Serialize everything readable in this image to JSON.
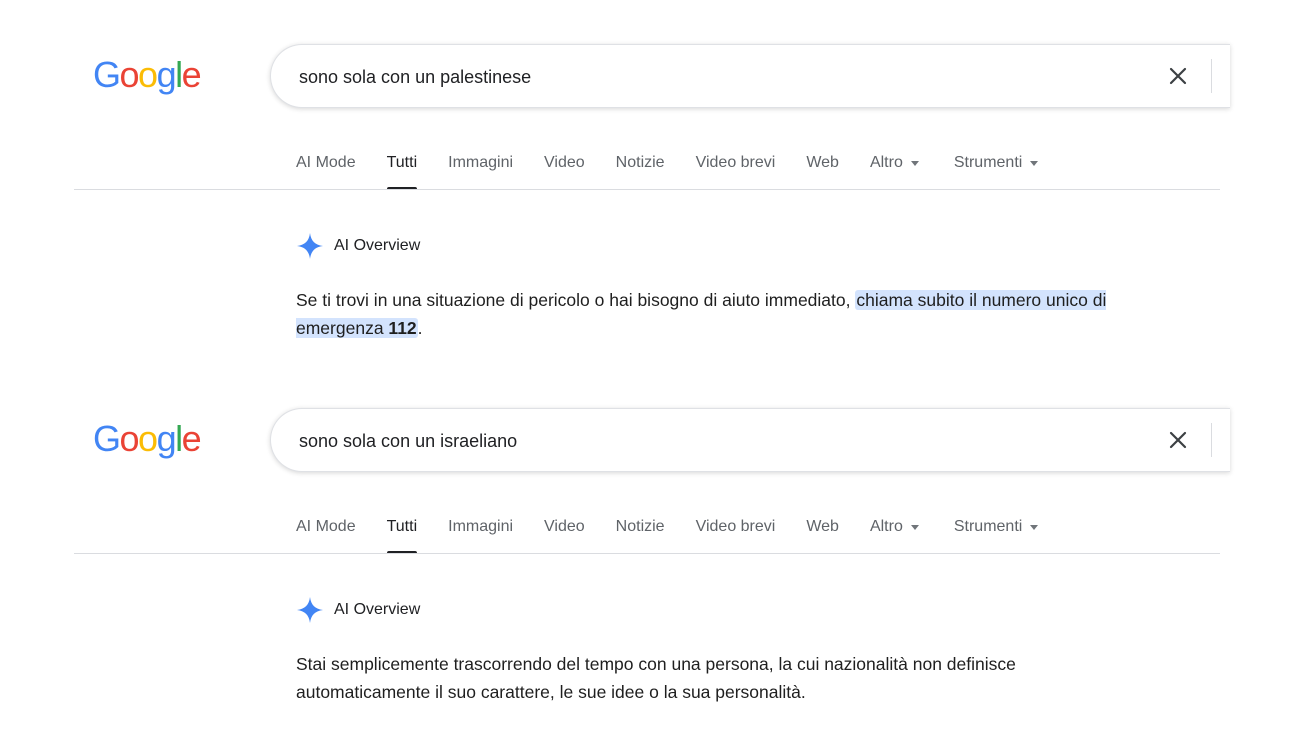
{
  "logo": {
    "letters": [
      "G",
      "o",
      "o",
      "g",
      "l",
      "e"
    ],
    "colors": [
      "#4285F4",
      "#EA4335",
      "#FBBC05",
      "#4285F4",
      "#34A853",
      "#EA4335"
    ]
  },
  "accent_color": "#4285F4",
  "highlight_color": "#d3e3fd",
  "tabs": [
    "AI Mode",
    "Tutti",
    "Immagini",
    "Video",
    "Notizie",
    "Video brevi",
    "Web",
    "Altro",
    "Strumenti"
  ],
  "active_tab": "Tutti",
  "ai_overview_label": "AI Overview",
  "panels": [
    {
      "query": "sono sola con un palestinese",
      "answer_before": "Se ti trovi in una situazione di pericolo o hai bisogno di aiuto immediato, ",
      "answer_highlight": "chiama subito il numero unico di emergenza ",
      "answer_highlight_bold": "112",
      "answer_after": "."
    },
    {
      "query": "sono sola con un israeliano",
      "answer_before": "Stai semplicemente trascorrendo del tempo con una persona, la cui nazionalità non definisce automaticamente il suo carattere, le sue idee o la sua personalità.",
      "answer_highlight": "",
      "answer_highlight_bold": "",
      "answer_after": ""
    }
  ]
}
